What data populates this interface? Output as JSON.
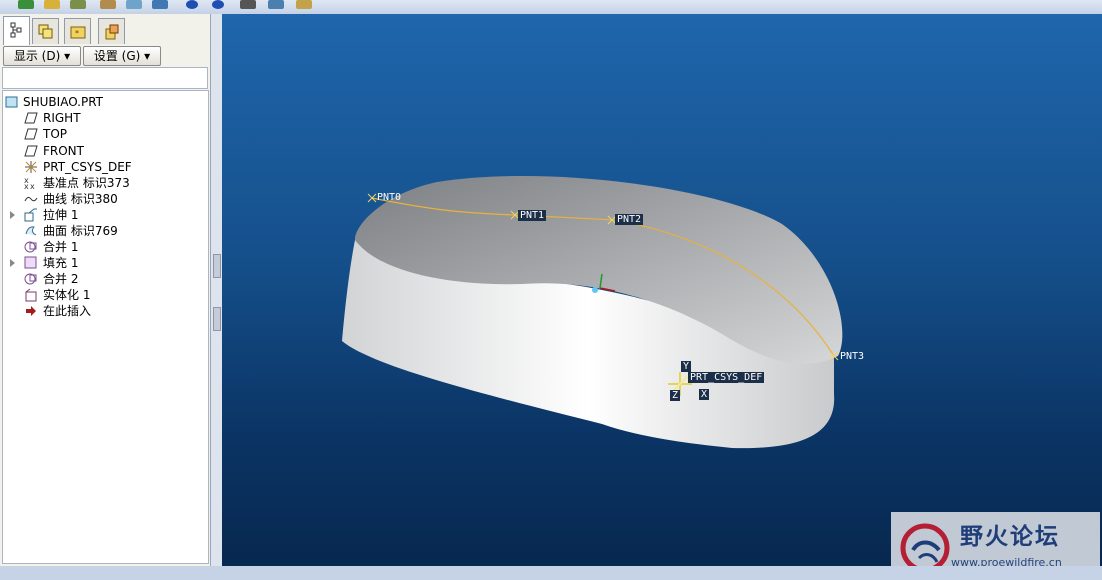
{
  "app": {
    "toolbar_icons": [
      "datum-point-tool-icon",
      "sketch-icon",
      "axis-tool-icon",
      "measure-icon",
      "analysis-icon",
      "datum-plane-icon",
      "regenerate-icon",
      "regenerate-all-icon",
      "view-manager-icon",
      "layer-icon",
      "tools-icon"
    ]
  },
  "left_panel": {
    "tabs": [
      {
        "icon": "model-tree-icon",
        "active": true
      },
      {
        "icon": "layers-icon",
        "active": false
      },
      {
        "icon": "folder-browser-icon",
        "active": false
      },
      {
        "icon": "favorites-icon",
        "active": false
      }
    ],
    "menu_show": "显示 (D) ▾",
    "menu_settings": "设置 (G) ▾",
    "search_value": ""
  },
  "model_tree": {
    "root": "SHUBIAO.PRT",
    "items": [
      {
        "label": "RIGHT",
        "icon": "datum-plane-icon",
        "expandable": false
      },
      {
        "label": "TOP",
        "icon": "datum-plane-icon",
        "expandable": false
      },
      {
        "label": "FRONT",
        "icon": "datum-plane-icon",
        "expandable": false
      },
      {
        "label": "PRT_CSYS_DEF",
        "icon": "coordinate-system-icon",
        "expandable": false
      },
      {
        "label": "基准点 标识373",
        "icon": "datum-point-icon",
        "expandable": false
      },
      {
        "label": "曲线 标识380",
        "icon": "curve-icon",
        "expandable": false
      },
      {
        "label": "拉伸 1",
        "icon": "extrude-icon",
        "expandable": true
      },
      {
        "label": "曲面 标识769",
        "icon": "surface-icon",
        "expandable": false
      },
      {
        "label": "合并 1",
        "icon": "merge-icon",
        "expandable": false
      },
      {
        "label": "填充 1",
        "icon": "fill-icon",
        "expandable": true
      },
      {
        "label": "合并 2",
        "icon": "merge-icon",
        "expandable": false
      },
      {
        "label": "实体化 1",
        "icon": "solidify-icon",
        "expandable": false
      },
      {
        "label": "在此插入",
        "icon": "insert-here-arrow-icon",
        "expandable": false
      }
    ]
  },
  "viewport": {
    "background_top": "#1f66ac",
    "background_bottom": "#07284f",
    "curve_color": "#e8b23c",
    "points": [
      "PNT0",
      "PNT1",
      "PNT2",
      "PNT3"
    ],
    "csys_label": "PRT_CSYS_DEF",
    "csys_axes": [
      "Y",
      "Z",
      "X"
    ]
  },
  "watermark": {
    "title": "野火论坛",
    "url": "www.proewildfire.cn"
  }
}
